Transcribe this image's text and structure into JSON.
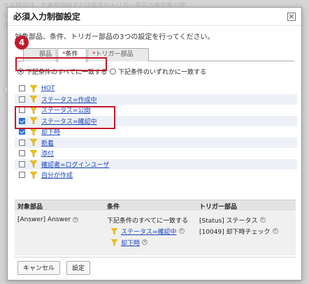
{
  "backdrop": {
    "rows": [
      "する部品は、文書登録時または指定のトリガー部品の確定要の際、",
      "グ",
      "ル",
      "",
      "",
      "",
      "",
      "",
      "",
      "",
      "",
      "",
      "",
      "",
      "",
      "",
      "",
      "",
      "",
      "",
      "",
      "",
      "",
      "",
      "",
      "",
      "",
      ""
    ]
  },
  "dialog": {
    "title": "必須入力制御設定",
    "description": "対象部品、条件、トリガー部品の3つの設定を行ってください。",
    "step_number": "4",
    "tabs": [
      {
        "label": "部品",
        "asterisk": "",
        "active": false
      },
      {
        "label": "条件",
        "asterisk": "*",
        "active": true
      },
      {
        "label": "トリガー部品",
        "asterisk": "*",
        "active": false
      }
    ],
    "match_options": [
      {
        "label": "下記条件のすべてに一致する",
        "selected": true
      },
      {
        "label": "下記条件のいずれかに一致する",
        "selected": false
      }
    ],
    "conditions": [
      {
        "label": "HOT",
        "checked": false
      },
      {
        "label": "ステータス=作成中",
        "checked": false
      },
      {
        "label": "ステータス=公開",
        "checked": false
      },
      {
        "label": "ステータス=確認中",
        "checked": true
      },
      {
        "label": "却下時",
        "checked": true
      },
      {
        "label": "新着",
        "checked": false
      },
      {
        "label": "添付",
        "checked": false
      },
      {
        "label": "確認者=ログインユーザ",
        "checked": false
      },
      {
        "label": "自分が作成",
        "checked": false
      }
    ],
    "summary": {
      "headers": [
        "対象部品",
        "条件",
        "トリガー部品"
      ],
      "target_part": "[Answer] Answer",
      "condition_mode": "下記条件のすべてに一致する",
      "selected_conditions": [
        "ステータス=確認中",
        "却下時"
      ],
      "trigger_parts": [
        "[Status] ステータス",
        "[10049] 却下時チェック"
      ]
    },
    "buttons": {
      "cancel": "キャンセル",
      "confirm": "設定"
    }
  },
  "colors": {
    "accent_red": "#c3192b",
    "link_blue": "#1a44b8",
    "check_blue": "#2d6fd6",
    "funnel_yellow": "#f2c200"
  }
}
